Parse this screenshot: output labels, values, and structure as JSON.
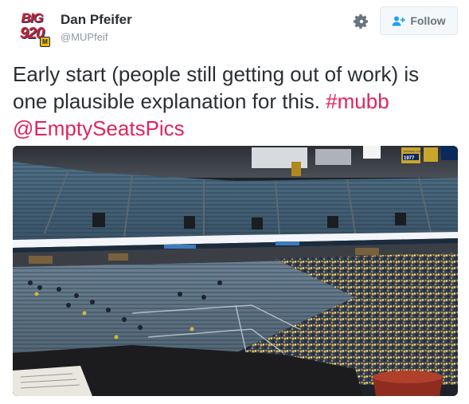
{
  "user": {
    "display_name": "Dan Pfeifer",
    "handle": "@MUPfeif",
    "avatar_logo_top": "BIG",
    "avatar_logo_bottom": "920",
    "avatar_badge": "M"
  },
  "actions": {
    "follow_label": "Follow",
    "settings_icon": "gear-icon",
    "follow_icon": "add-user-icon"
  },
  "tweet": {
    "text_prefix": "Early start (people still getting out of work) is one plausible explanation for this. ",
    "hashtag": "#mubb",
    "mention": "@EmptySeatsPics"
  },
  "photo": {
    "banner_text": "1977",
    "banner_caption": "NATIONAL CHAMPS"
  },
  "colors": {
    "link": "#e0245e",
    "text": "#292f33",
    "muted": "#8899a6",
    "button_bg": "#f5f8fa"
  }
}
